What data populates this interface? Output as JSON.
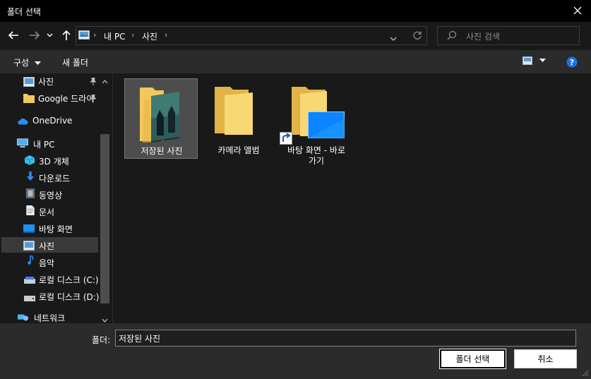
{
  "window": {
    "title": "폴더 선택"
  },
  "nav": {
    "breadcrumb": [
      "내 PC",
      "사진"
    ],
    "search_placeholder": "사진 검색"
  },
  "toolbar": {
    "organize": "구성",
    "new_folder": "새 폴더"
  },
  "sidebar": {
    "items": [
      {
        "label": "사진",
        "icon": "pictures-icon",
        "pinned": true
      },
      {
        "label": "Google 드라이",
        "icon": "folder-icon",
        "pinned": true
      },
      {
        "label": "OneDrive",
        "icon": "cloud-icon"
      },
      {
        "label": "내 PC",
        "icon": "computer-icon"
      },
      {
        "label": "3D 개체",
        "icon": "cube-icon"
      },
      {
        "label": "다운로드",
        "icon": "download-icon"
      },
      {
        "label": "동영상",
        "icon": "video-icon"
      },
      {
        "label": "문서",
        "icon": "document-icon"
      },
      {
        "label": "바탕 화면",
        "icon": "desktop-icon"
      },
      {
        "label": "사진",
        "icon": "pictures-icon",
        "selected": true
      },
      {
        "label": "음악",
        "icon": "music-icon"
      },
      {
        "label": "로컬 디스크 (C:)",
        "icon": "drive-icon"
      },
      {
        "label": "로컬 디스크 (D:)",
        "icon": "drive-icon"
      },
      {
        "label": "네트워크",
        "icon": "network-icon"
      }
    ]
  },
  "content": {
    "items": [
      {
        "label": "저장된 사진",
        "type": "folder-with-image",
        "selected": true
      },
      {
        "label": "카메라 앨범",
        "type": "folder"
      },
      {
        "label_line1": "바탕 화면 - 바로",
        "label_line2": "가기",
        "type": "shortcut"
      }
    ]
  },
  "bottom": {
    "folder_label": "폴더:",
    "folder_value": "저장된 사진",
    "ok_label": "폴더 선택",
    "cancel_label": "취소"
  },
  "colors": {
    "folder": "#f3c85b",
    "accent": "#0a84ff",
    "selection": "#3a3a3a"
  }
}
